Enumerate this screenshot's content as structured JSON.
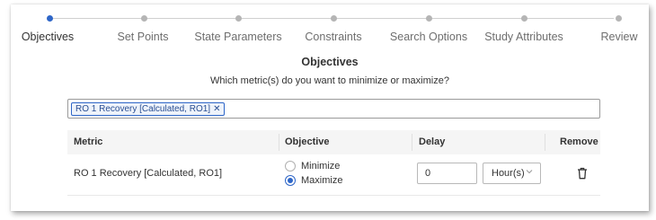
{
  "stepper": {
    "steps": [
      {
        "label": "Objectives",
        "active": true
      },
      {
        "label": "Set Points",
        "active": false
      },
      {
        "label": "State Parameters",
        "active": false
      },
      {
        "label": "Constraints",
        "active": false
      },
      {
        "label": "Search Options",
        "active": false
      },
      {
        "label": "Study Attributes",
        "active": false
      },
      {
        "label": "Review",
        "active": false
      }
    ]
  },
  "page": {
    "heading": "Objectives",
    "question": "Which metric(s) do you want to minimize or maximize?"
  },
  "metric_select": {
    "chips": [
      {
        "label": "RO 1 Recovery [Calculated, RO1]",
        "remove_icon": "x"
      }
    ]
  },
  "table": {
    "headers": {
      "metric": "Metric",
      "objective": "Objective",
      "delay": "Delay",
      "remove": "Remove"
    },
    "rows": [
      {
        "metric": "RO 1 Recovery [Calculated, RO1]",
        "options": [
          "Minimize",
          "Maximize"
        ],
        "selected_option": "Maximize",
        "delay_value": "0",
        "delay_unit": "Hour(s)",
        "remove_icon": "trash-icon"
      }
    ]
  },
  "colors": {
    "accent": "#2e66c8",
    "header_bg": "#f5f5f5"
  }
}
